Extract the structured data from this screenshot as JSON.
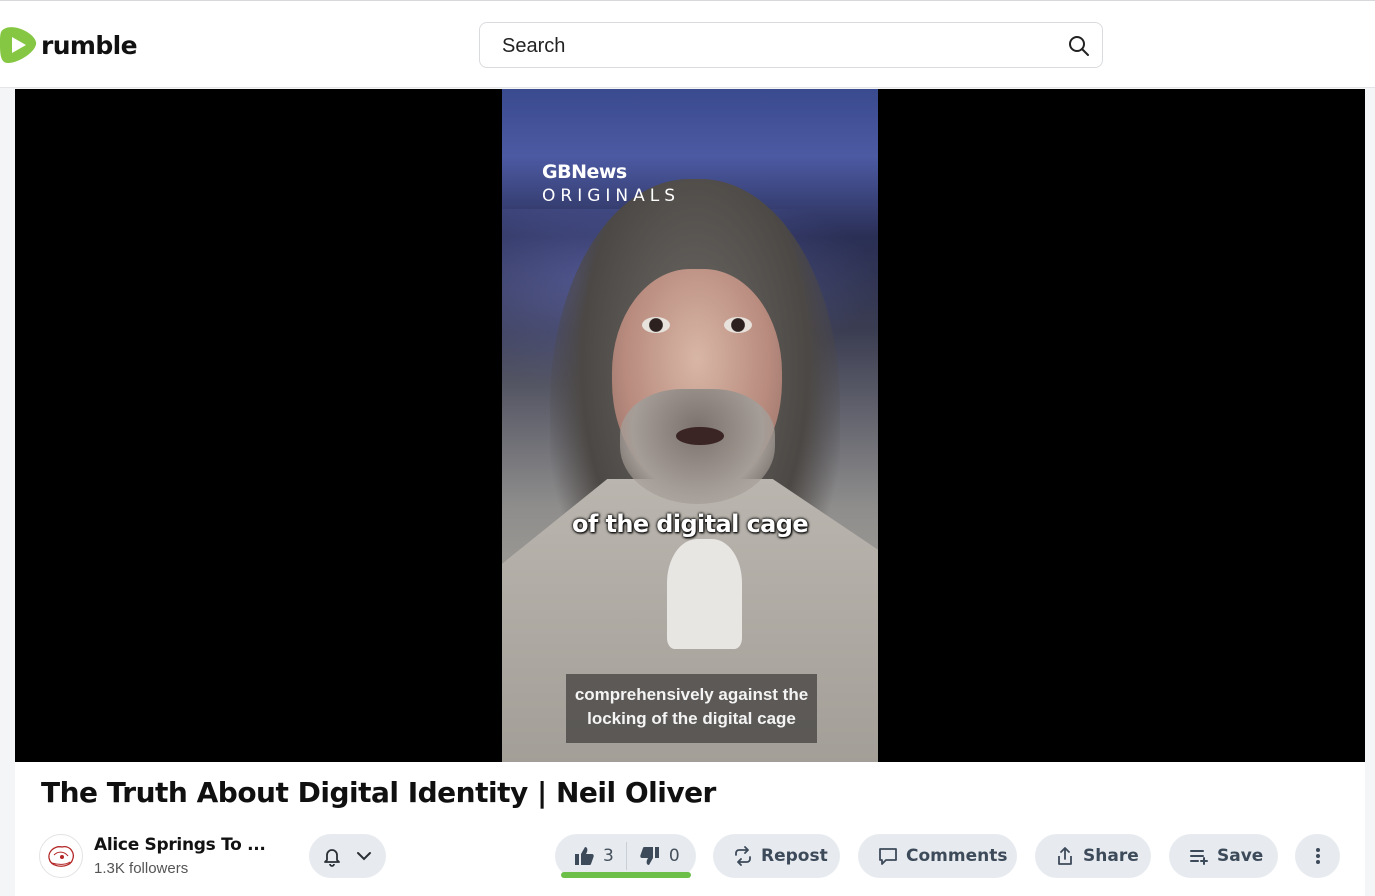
{
  "header": {
    "logo_text": "rumble",
    "search_placeholder": "Search"
  },
  "video": {
    "overlay_brand_line1": "GBNews",
    "overlay_brand_line2": "ORIGINALS",
    "caption_large": "of the digital cage",
    "subtitle_line1": "comprehensively against the",
    "subtitle_line2": "locking of the digital cage"
  },
  "title": "The Truth About Digital Identity | Neil Oliver",
  "channel": {
    "name": "Alice Springs To ...",
    "followers": "1.3K followers"
  },
  "actions": {
    "likes": "3",
    "dislikes": "0",
    "repost_label": "Repost",
    "comments_label": "Comments",
    "share_label": "Share",
    "save_label": "Save"
  },
  "colors": {
    "brand_green": "#85c742",
    "vote_bar": "#6cc04a",
    "pill_bg": "#e7ebef"
  },
  "icons": [
    "rumble-logo-icon",
    "search-icon",
    "bell-icon",
    "chevron-down-icon",
    "thumbs-up-icon",
    "thumbs-down-icon",
    "repost-icon",
    "comment-icon",
    "share-icon",
    "playlist-add-icon",
    "more-vertical-icon"
  ]
}
